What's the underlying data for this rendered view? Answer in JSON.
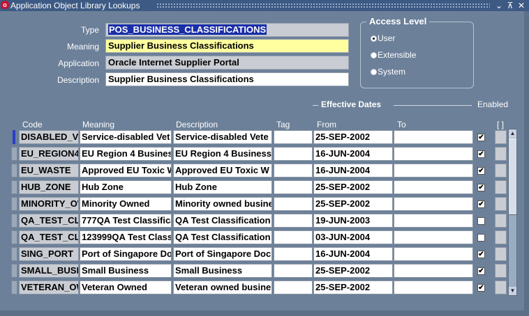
{
  "window": {
    "title": "Application Object Library Lookups",
    "controls": [
      "⌄",
      "⊼",
      "✕"
    ]
  },
  "header_fields": {
    "type_label": "Type",
    "type_value": "POS_BUSINESS_CLASSIFICATIONS",
    "meaning_label": "Meaning",
    "meaning_value": "Supplier Business Classifications",
    "application_label": "Application",
    "application_value": "Oracle Internet Supplier Portal",
    "description_label": "Description",
    "description_value": "Supplier Business Classifications"
  },
  "access_level": {
    "title": "Access Level",
    "options": [
      "User",
      "Extensible",
      "System"
    ],
    "selected": "User"
  },
  "table": {
    "group_header": "Effective Dates",
    "enabled_header": "Enabled",
    "dff_header": "[ ]",
    "columns": {
      "code": "Code",
      "meaning": "Meaning",
      "description": "Description",
      "tag": "Tag",
      "from": "From",
      "to": "To"
    },
    "rows": [
      {
        "code": "DISABLED_V",
        "meaning": "Service-disabled Vet",
        "description": "Service-disabled Vete",
        "tag": "",
        "from": "25-SEP-2002",
        "to": "",
        "enabled": "✔"
      },
      {
        "code": "EU_REGION4",
        "meaning": "EU Region 4 Busines",
        "description": "EU Region 4 Business",
        "tag": "",
        "from": "16-JUN-2004",
        "to": "",
        "enabled": "✔"
      },
      {
        "code": "EU_WASTE",
        "meaning": "Approved EU Toxic W",
        "description": "Approved EU Toxic W",
        "tag": "",
        "from": "16-JUN-2004",
        "to": "",
        "enabled": "✔"
      },
      {
        "code": "HUB_ZONE",
        "meaning": "Hub Zone",
        "description": "Hub Zone",
        "tag": "",
        "from": "25-SEP-2002",
        "to": "",
        "enabled": "✔"
      },
      {
        "code": "MINORITY_OW",
        "meaning": "Minority Owned",
        "description": "Minority owned busine",
        "tag": "",
        "from": "25-SEP-2002",
        "to": "",
        "enabled": "✔"
      },
      {
        "code": "QA_TEST_CL",
        "meaning": "777QA Test Classifica",
        "description": "QA Test Classification",
        "tag": "",
        "from": "19-JUN-2003",
        "to": "",
        "enabled": ""
      },
      {
        "code": "QA_TEST_CL",
        "meaning": "123999QA Test Class",
        "description": "QA Test Classification",
        "tag": "",
        "from": "03-JUN-2004",
        "to": "",
        "enabled": ""
      },
      {
        "code": "SING_PORT",
        "meaning": "Port of Singapore Do",
        "description": "Port of Singapore Doc",
        "tag": "",
        "from": "16-JUN-2004",
        "to": "",
        "enabled": "✔"
      },
      {
        "code": "SMALL_BUSI",
        "meaning": "Small Business",
        "description": "Small Business",
        "tag": "",
        "from": "25-SEP-2002",
        "to": "",
        "enabled": "✔"
      },
      {
        "code": "VETERAN_OW",
        "meaning": "Veteran Owned",
        "description": "Veteran owned busine",
        "tag": "",
        "from": "25-SEP-2002",
        "to": "",
        "enabled": "✔"
      }
    ]
  },
  "colors": {
    "window_bg": "#6c8099",
    "titlebar_bg": "#3d5a84",
    "selection": "#1a2ea8",
    "required_field": "#ffff9f",
    "readonly_field": "#c9cdd3"
  }
}
